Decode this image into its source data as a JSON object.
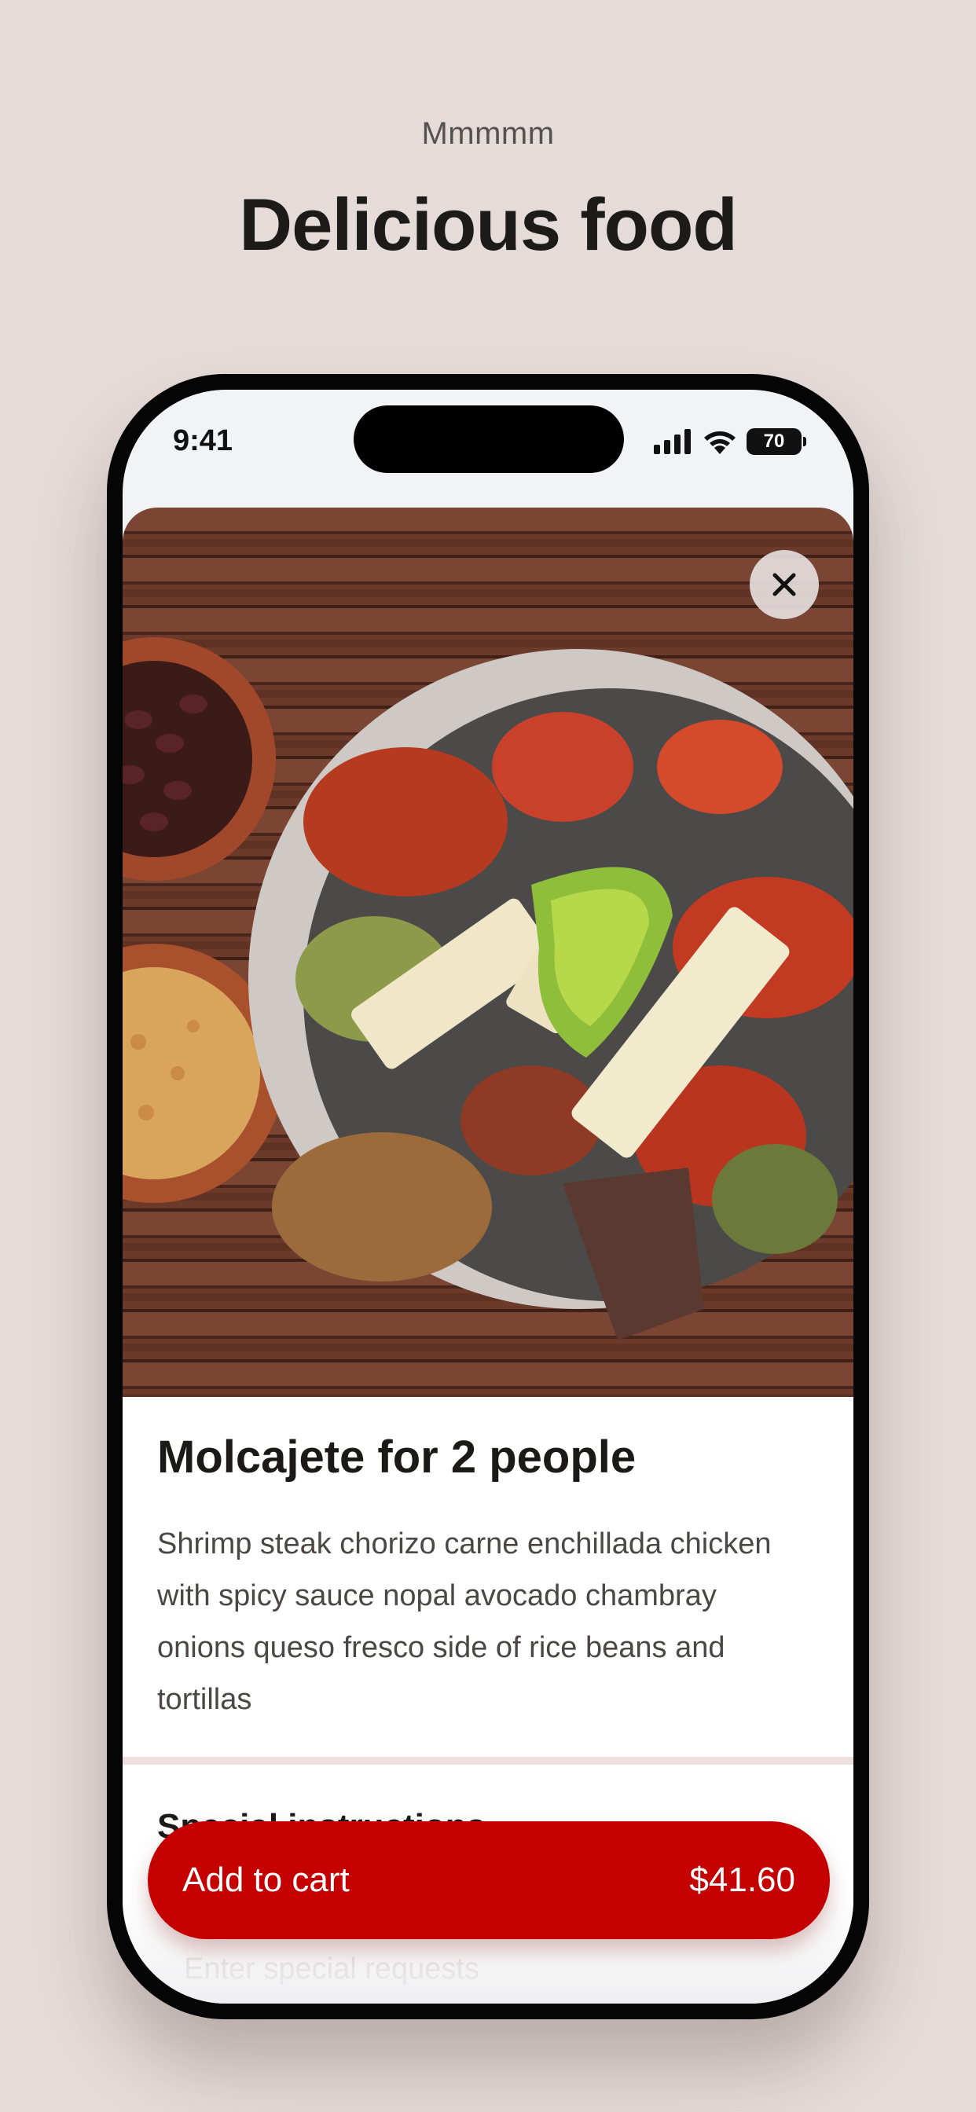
{
  "header": {
    "kicker": "Mmmmm",
    "headline": "Delicious food"
  },
  "status_bar": {
    "time": "9:41",
    "battery": "70",
    "icons": [
      "signal-icon",
      "wifi-icon",
      "battery-icon"
    ]
  },
  "item": {
    "title": "Molcajete for 2 people",
    "description": "Shrimp steak chorizo carne enchillada chicken with spicy sauce nopal avocado chambray onions queso fresco side of rice beans and tortillas",
    "image_subject": "molcajete platter with meats, nopal, avocado, cheese, rice and beans"
  },
  "special_instructions": {
    "title": "Special instructions",
    "placeholder": "Enter special requests"
  },
  "cart": {
    "label": "Add to cart",
    "price": "$41.60"
  },
  "colors": {
    "background": "#e5dbd9",
    "accent": "#c50000",
    "divider": "#ecdfdd"
  }
}
